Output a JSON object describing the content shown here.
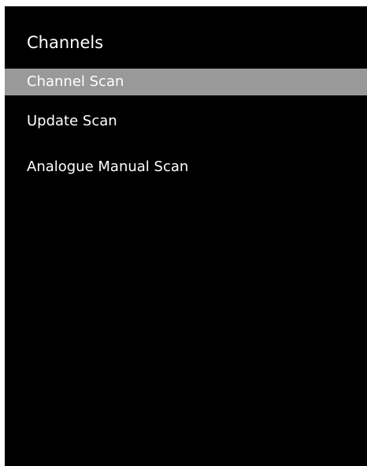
{
  "menu": {
    "title": "Channels",
    "items": [
      {
        "label": "Channel Scan",
        "selected": true
      },
      {
        "label": "Update Scan",
        "selected": false
      },
      {
        "label": "Analogue Manual Scan",
        "selected": false
      }
    ]
  },
  "colors": {
    "background": "#000000",
    "highlight": "#999999",
    "text": "#ffffff"
  }
}
